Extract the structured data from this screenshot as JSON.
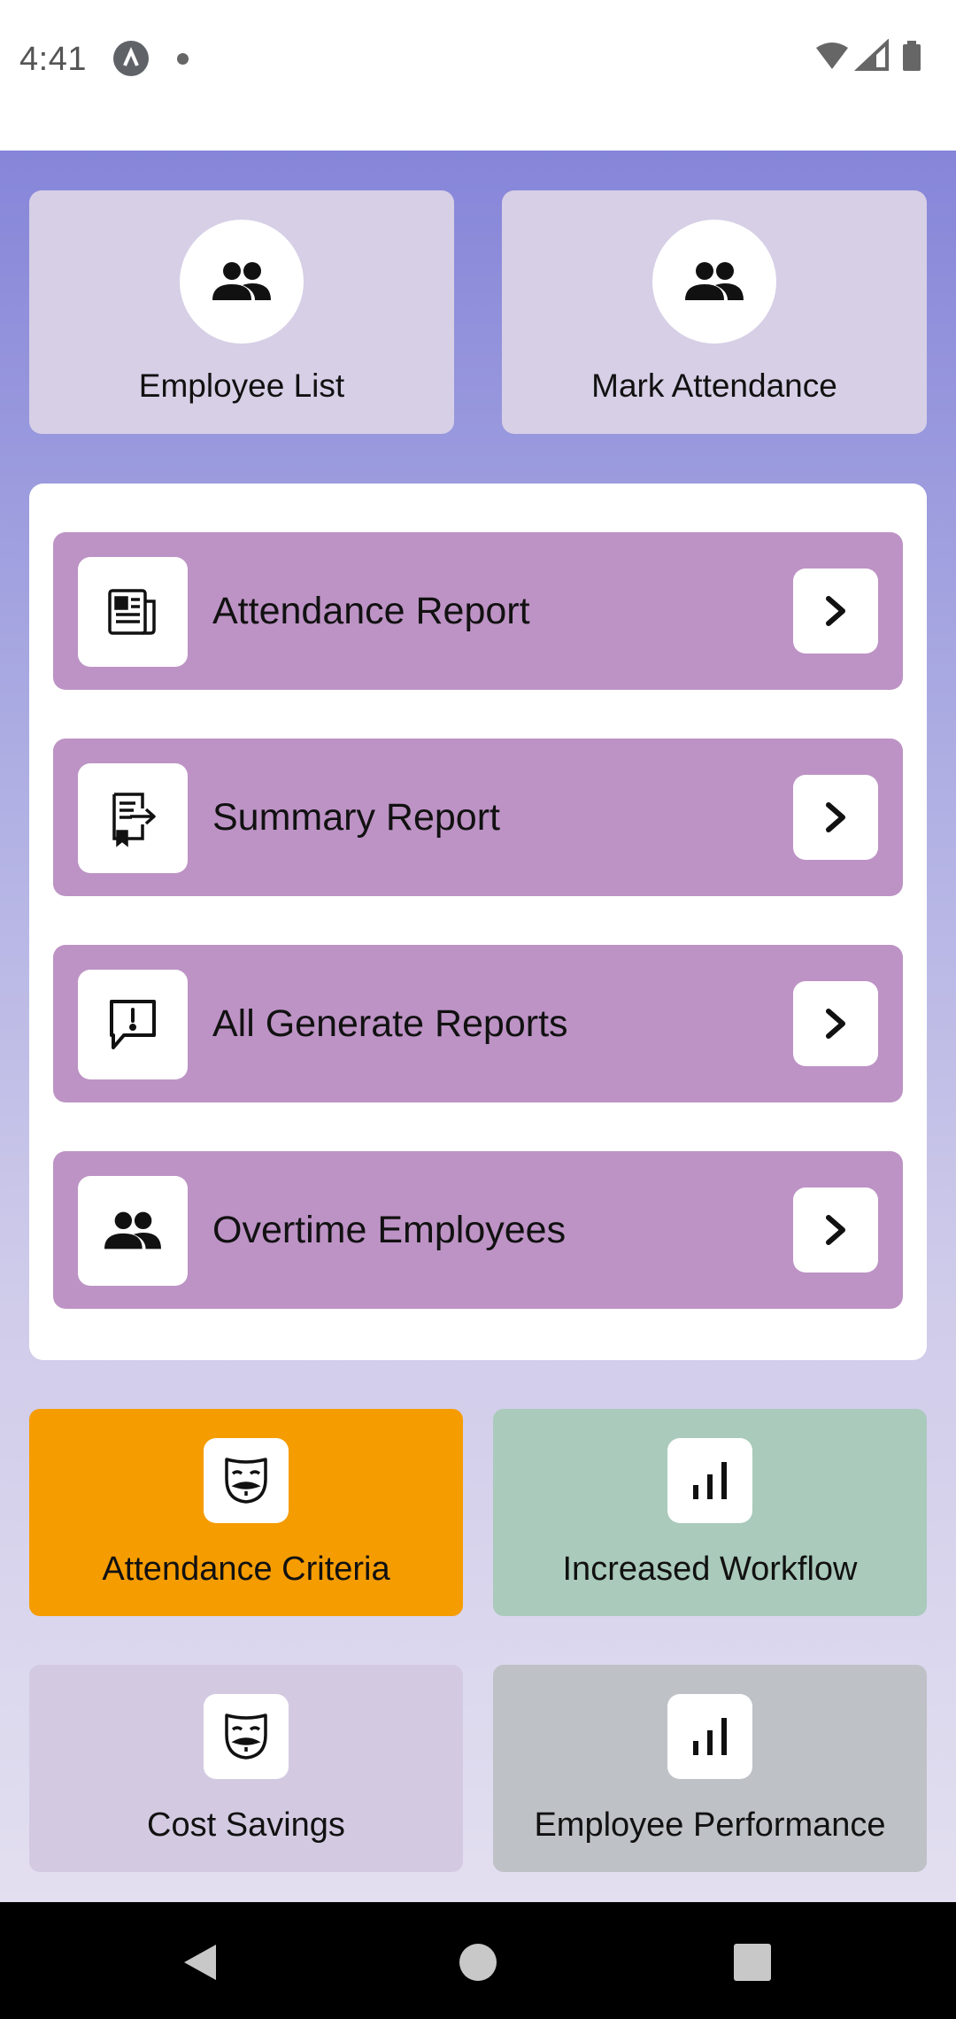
{
  "status_bar": {
    "time": "4:41"
  },
  "top_cards": [
    {
      "label": "Employee List",
      "icon": "people-icon"
    },
    {
      "label": "Mark Attendance",
      "icon": "people-icon"
    }
  ],
  "reports": [
    {
      "title": "Attendance Report",
      "icon": "newspaper-icon"
    },
    {
      "title": "Summary Report",
      "icon": "report-export-icon"
    },
    {
      "title": "All Generate Reports",
      "icon": "feedback-icon"
    },
    {
      "title": "Overtime Employees",
      "icon": "people-icon"
    }
  ],
  "tiles": [
    {
      "label": "Attendance Criteria",
      "icon": "mask-icon",
      "color": "#f59c00"
    },
    {
      "label": "Increased Workflow",
      "icon": "bar-chart-icon",
      "color": "#aacabb"
    },
    {
      "label": "Cost Savings",
      "icon": "mask-icon",
      "color": "#d3cae2"
    },
    {
      "label": "Employee Performance",
      "icon": "bar-chart-icon",
      "color": "#bec1c6"
    }
  ],
  "colors": {
    "report_item": "#bd93c5",
    "top_card": "#d6cfe6"
  }
}
